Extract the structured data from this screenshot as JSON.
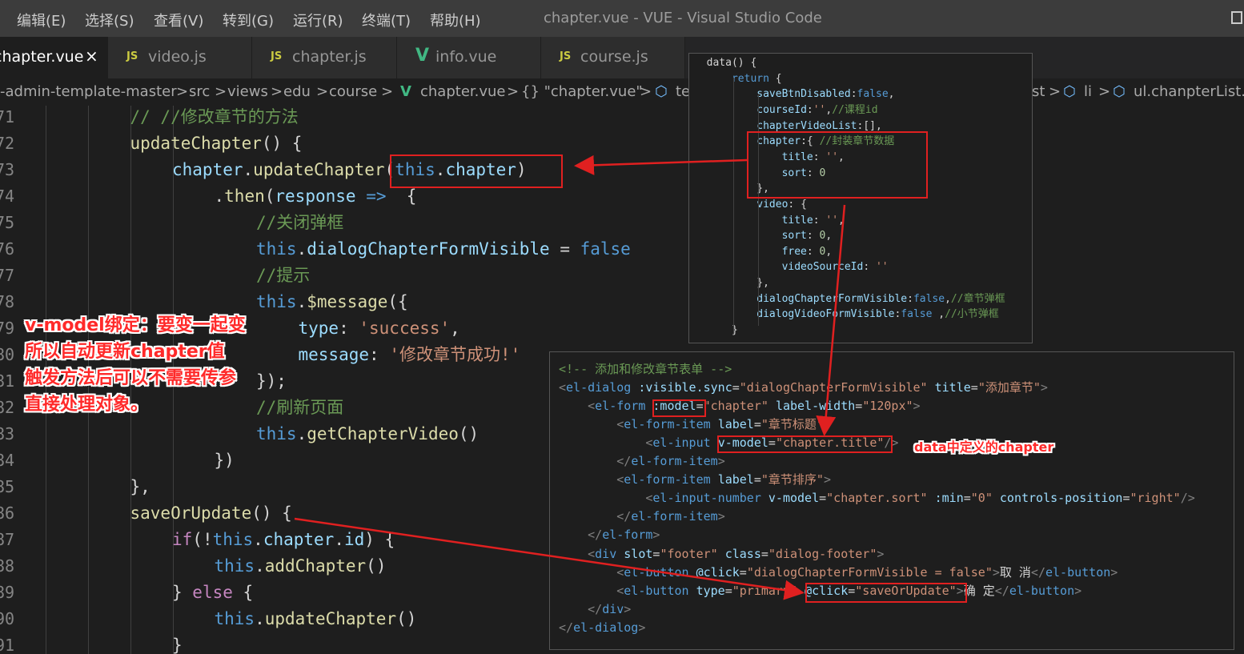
{
  "menu": [
    "编辑(E)",
    "选择(S)",
    "查看(V)",
    "转到(G)",
    "运行(R)",
    "终端(T)",
    "帮助(H)"
  ],
  "window_title": "chapter.vue - VUE - Visual Studio Code",
  "tabs": [
    {
      "label": "chapter.vue",
      "icon": "vue-icon",
      "active": true
    },
    {
      "label": "video.js",
      "icon": "js-icon",
      "active": false
    },
    {
      "label": "chapter.js",
      "icon": "js-icon",
      "active": false
    },
    {
      "label": "info.vue",
      "icon": "vue-icon",
      "active": false
    },
    {
      "label": "course.js",
      "icon": "js-icon",
      "active": false
    }
  ],
  "tab_icons": {
    "js": "JS",
    "vue": "V",
    "close": "×"
  },
  "breadcrumb": {
    "items": [
      "-admin-template-master",
      "src",
      "views",
      "edu",
      "course",
      "chapter.vue",
      "{} \"chapter.vue\"",
      "te"
    ],
    "tail": [
      "st",
      "li",
      "ul.chanpterList.v"
    ],
    "separator": ">"
  },
  "code_lines": [
    {
      "n": "71",
      "indent": 3,
      "tokens": [
        [
          "c-comment",
          "// //修改章节的方法"
        ]
      ]
    },
    {
      "n": "72",
      "indent": 3,
      "tokens": [
        [
          "c-fn",
          "updateChapter"
        ],
        [
          "c-punc",
          "() {"
        ]
      ]
    },
    {
      "n": "73",
      "indent": 4,
      "tokens": [
        [
          "c-var",
          "chapter"
        ],
        [
          "c-punc",
          "."
        ],
        [
          "c-fn",
          "updateChapter"
        ],
        [
          "c-punc",
          "("
        ],
        [
          "c-kw",
          "this"
        ],
        [
          "c-punc",
          "."
        ],
        [
          "c-var",
          "chapter"
        ],
        [
          "c-punc",
          ")"
        ]
      ]
    },
    {
      "n": "74",
      "indent": 5,
      "tokens": [
        [
          "c-punc",
          "."
        ],
        [
          "c-fn",
          "then"
        ],
        [
          "c-punc",
          "("
        ],
        [
          "c-var",
          "response"
        ],
        [
          "c-punc",
          " "
        ],
        [
          "c-kw",
          "=>"
        ],
        [
          "c-punc",
          "  {"
        ]
      ]
    },
    {
      "n": "75",
      "indent": 6,
      "tokens": [
        [
          "c-comment",
          "//关闭弹框"
        ]
      ]
    },
    {
      "n": "76",
      "indent": 6,
      "tokens": [
        [
          "c-kw",
          "this"
        ],
        [
          "c-punc",
          "."
        ],
        [
          "c-var",
          "dialogChapterFormVisible"
        ],
        [
          "c-punc",
          " = "
        ],
        [
          "c-kw",
          "false"
        ]
      ]
    },
    {
      "n": "77",
      "indent": 6,
      "tokens": [
        [
          "c-comment",
          "//提示"
        ]
      ]
    },
    {
      "n": "78",
      "indent": 6,
      "tokens": [
        [
          "c-kw",
          "this"
        ],
        [
          "c-punc",
          "."
        ],
        [
          "c-fn",
          "$message"
        ],
        [
          "c-punc",
          "({"
        ]
      ]
    },
    {
      "n": "79",
      "indent": 7,
      "tokens": [
        [
          "c-var",
          "type"
        ],
        [
          "c-punc",
          ": "
        ],
        [
          "c-str",
          "'success'"
        ],
        [
          "c-punc",
          ","
        ]
      ]
    },
    {
      "n": "80",
      "indent": 7,
      "tokens": [
        [
          "c-var",
          "message"
        ],
        [
          "c-punc",
          ": "
        ],
        [
          "c-str",
          "'修改章节成功!'"
        ]
      ]
    },
    {
      "n": "81",
      "indent": 6,
      "tokens": [
        [
          "c-punc",
          "});"
        ]
      ]
    },
    {
      "n": "82",
      "indent": 6,
      "tokens": [
        [
          "c-comment",
          "//刷新页面"
        ]
      ]
    },
    {
      "n": "83",
      "indent": 6,
      "tokens": [
        [
          "c-kw",
          "this"
        ],
        [
          "c-punc",
          "."
        ],
        [
          "c-fn",
          "getChapterVideo"
        ],
        [
          "c-punc",
          "()"
        ]
      ]
    },
    {
      "n": "84",
      "indent": 5,
      "tokens": [
        [
          "c-punc",
          "})"
        ]
      ]
    },
    {
      "n": "85",
      "indent": 3,
      "tokens": [
        [
          "c-punc",
          "},"
        ]
      ]
    },
    {
      "n": "86",
      "indent": 3,
      "tokens": [
        [
          "c-fn",
          "saveOrUpdate"
        ],
        [
          "c-punc",
          "() {"
        ]
      ]
    },
    {
      "n": "87",
      "indent": 4,
      "tokens": [
        [
          "c-ctrl",
          "if"
        ],
        [
          "c-punc",
          "(!"
        ],
        [
          "c-kw",
          "this"
        ],
        [
          "c-punc",
          "."
        ],
        [
          "c-var",
          "chapter"
        ],
        [
          "c-punc",
          "."
        ],
        [
          "c-var",
          "id"
        ],
        [
          "c-punc",
          ") {"
        ]
      ]
    },
    {
      "n": "88",
      "indent": 5,
      "tokens": [
        [
          "c-kw",
          "this"
        ],
        [
          "c-punc",
          "."
        ],
        [
          "c-fn",
          "addChapter"
        ],
        [
          "c-punc",
          "()"
        ]
      ]
    },
    {
      "n": "89",
      "indent": 4,
      "tokens": [
        [
          "c-punc",
          "} "
        ],
        [
          "c-ctrl",
          "else"
        ],
        [
          "c-punc",
          " {"
        ]
      ]
    },
    {
      "n": "90",
      "indent": 5,
      "tokens": [
        [
          "c-kw",
          "this"
        ],
        [
          "c-punc",
          "."
        ],
        [
          "c-fn",
          "updateChapter"
        ],
        [
          "c-punc",
          "()"
        ]
      ]
    },
    {
      "n": "91",
      "indent": 4,
      "tokens": [
        [
          "c-punc",
          "}"
        ]
      ]
    }
  ],
  "data_panel_lines": [
    [
      [
        "t-text",
        "  data() {"
      ]
    ],
    [
      [
        "t-text",
        "      "
      ],
      [
        "t-tag",
        "return"
      ],
      [
        "t-text",
        " {"
      ]
    ],
    [
      [
        "t-text",
        "          "
      ],
      [
        "t-attr",
        "saveBtnDisabled"
      ],
      [
        "t-text",
        ":"
      ],
      [
        "t-tag",
        "false"
      ],
      [
        "t-text",
        ","
      ]
    ],
    [
      [
        "t-text",
        "          "
      ],
      [
        "t-attr",
        "courseId"
      ],
      [
        "t-text",
        ":"
      ],
      [
        "t-str",
        "''"
      ],
      [
        "t-text",
        ","
      ],
      [
        "c-comment",
        "//课程id"
      ]
    ],
    [
      [
        "t-text",
        "          "
      ],
      [
        "t-attr",
        "chapterVideoList"
      ],
      [
        "t-text",
        ":[],"
      ]
    ],
    [
      [
        "t-text",
        "          "
      ],
      [
        "t-attr",
        "chapter"
      ],
      [
        "t-text",
        ":{ "
      ],
      [
        "c-comment",
        "//封装章节数据"
      ]
    ],
    [
      [
        "t-text",
        "              "
      ],
      [
        "t-attr",
        "title"
      ],
      [
        "t-text",
        ": "
      ],
      [
        "t-str",
        "''"
      ],
      [
        "t-text",
        ","
      ]
    ],
    [
      [
        "t-text",
        "              "
      ],
      [
        "t-attr",
        "sort"
      ],
      [
        "t-text",
        ": "
      ],
      [
        "c-num",
        "0"
      ]
    ],
    [
      [
        "t-text",
        "          },"
      ]
    ],
    [
      [
        "t-text",
        "          "
      ],
      [
        "t-attr",
        "video"
      ],
      [
        "t-text",
        ": {"
      ]
    ],
    [
      [
        "t-text",
        "              "
      ],
      [
        "t-attr",
        "title"
      ],
      [
        "t-text",
        ": "
      ],
      [
        "t-str",
        "''"
      ],
      [
        "t-text",
        ","
      ]
    ],
    [
      [
        "t-text",
        "              "
      ],
      [
        "t-attr",
        "sort"
      ],
      [
        "t-text",
        ": "
      ],
      [
        "c-num",
        "0"
      ],
      [
        "t-text",
        ","
      ]
    ],
    [
      [
        "t-text",
        "              "
      ],
      [
        "t-attr",
        "free"
      ],
      [
        "t-text",
        ": "
      ],
      [
        "c-num",
        "0"
      ],
      [
        "t-text",
        ","
      ]
    ],
    [
      [
        "t-text",
        "              "
      ],
      [
        "t-attr",
        "videoSourceId"
      ],
      [
        "t-text",
        ": "
      ],
      [
        "t-str",
        "''"
      ]
    ],
    [
      [
        "t-text",
        "          },"
      ]
    ],
    [
      [
        "t-text",
        "          "
      ],
      [
        "t-attr",
        "dialogChapterFormVisible"
      ],
      [
        "t-text",
        ":"
      ],
      [
        "t-tag",
        "false"
      ],
      [
        "t-text",
        ","
      ],
      [
        "c-comment",
        "//章节弹框"
      ]
    ],
    [
      [
        "t-text",
        "          "
      ],
      [
        "t-attr",
        "dialogVideoFormVisible"
      ],
      [
        "t-text",
        ":"
      ],
      [
        "t-tag",
        "false"
      ],
      [
        "t-text",
        " ,"
      ],
      [
        "c-comment",
        "//小节弹框"
      ]
    ],
    [
      [
        "t-text",
        "      }"
      ]
    ]
  ],
  "template_panel_lines": [
    [
      [
        "c-comment",
        "<!-- 添加和修改章节表单 -->"
      ]
    ],
    [
      [
        "t-punc",
        "<"
      ],
      [
        "t-tag",
        "el-dialog"
      ],
      [
        "t-text",
        " "
      ],
      [
        "t-attr",
        ":visible.sync"
      ],
      [
        "t-text",
        "="
      ],
      [
        "t-str",
        "\"dialogChapterFormVisible\""
      ],
      [
        "t-text",
        " "
      ],
      [
        "t-attr",
        "title"
      ],
      [
        "t-text",
        "="
      ],
      [
        "t-str",
        "\"添加章节\""
      ],
      [
        "t-punc",
        ">"
      ]
    ],
    [
      [
        "t-text",
        "    "
      ],
      [
        "t-punc",
        "<"
      ],
      [
        "t-tag",
        "el-form"
      ],
      [
        "t-text",
        " "
      ],
      [
        "t-attr",
        ":model"
      ],
      [
        "t-text",
        "="
      ],
      [
        "t-str",
        "\"chapter\""
      ],
      [
        "t-text",
        " "
      ],
      [
        "t-attr",
        "label-width"
      ],
      [
        "t-text",
        "="
      ],
      [
        "t-str",
        "\"120px\""
      ],
      [
        "t-punc",
        ">"
      ]
    ],
    [
      [
        "t-text",
        "        "
      ],
      [
        "t-punc",
        "<"
      ],
      [
        "t-tag",
        "el-form-item"
      ],
      [
        "t-text",
        " "
      ],
      [
        "t-attr",
        "label"
      ],
      [
        "t-text",
        "="
      ],
      [
        "t-str",
        "\"章节标题\""
      ],
      [
        "t-punc",
        ">"
      ]
    ],
    [
      [
        "t-text",
        "            "
      ],
      [
        "t-punc",
        "<"
      ],
      [
        "t-tag",
        "el-input"
      ],
      [
        "t-text",
        " "
      ],
      [
        "t-attr",
        "v-model"
      ],
      [
        "t-text",
        "="
      ],
      [
        "t-str",
        "\"chapter.title\""
      ],
      [
        "t-punc",
        "/>"
      ]
    ],
    [
      [
        "t-text",
        "        "
      ],
      [
        "t-punc",
        "</"
      ],
      [
        "t-tag",
        "el-form-item"
      ],
      [
        "t-punc",
        ">"
      ]
    ],
    [
      [
        "t-text",
        "        "
      ],
      [
        "t-punc",
        "<"
      ],
      [
        "t-tag",
        "el-form-item"
      ],
      [
        "t-text",
        " "
      ],
      [
        "t-attr",
        "label"
      ],
      [
        "t-text",
        "="
      ],
      [
        "t-str",
        "\"章节排序\""
      ],
      [
        "t-punc",
        ">"
      ]
    ],
    [
      [
        "t-text",
        "            "
      ],
      [
        "t-punc",
        "<"
      ],
      [
        "t-tag",
        "el-input-number"
      ],
      [
        "t-text",
        " "
      ],
      [
        "t-attr",
        "v-model"
      ],
      [
        "t-text",
        "="
      ],
      [
        "t-str",
        "\"chapter.sort\""
      ],
      [
        "t-text",
        " "
      ],
      [
        "t-attr",
        ":min"
      ],
      [
        "t-text",
        "="
      ],
      [
        "t-str",
        "\"0\""
      ],
      [
        "t-text",
        " "
      ],
      [
        "t-attr",
        "controls-position"
      ],
      [
        "t-text",
        "="
      ],
      [
        "t-str",
        "\"right\""
      ],
      [
        "t-punc",
        "/>"
      ]
    ],
    [
      [
        "t-text",
        "        "
      ],
      [
        "t-punc",
        "</"
      ],
      [
        "t-tag",
        "el-form-item"
      ],
      [
        "t-punc",
        ">"
      ]
    ],
    [
      [
        "t-text",
        "    "
      ],
      [
        "t-punc",
        "</"
      ],
      [
        "t-tag",
        "el-form"
      ],
      [
        "t-punc",
        ">"
      ]
    ],
    [
      [
        "t-text",
        "    "
      ],
      [
        "t-punc",
        "<"
      ],
      [
        "t-tag",
        "div"
      ],
      [
        "t-text",
        " "
      ],
      [
        "t-attr",
        "slot"
      ],
      [
        "t-text",
        "="
      ],
      [
        "t-str",
        "\"footer\""
      ],
      [
        "t-text",
        " "
      ],
      [
        "t-attr",
        "class"
      ],
      [
        "t-text",
        "="
      ],
      [
        "t-str",
        "\"dialog-footer\""
      ],
      [
        "t-punc",
        ">"
      ]
    ],
    [
      [
        "t-text",
        "        "
      ],
      [
        "t-punc",
        "<"
      ],
      [
        "t-tag",
        "el-button"
      ],
      [
        "t-text",
        " "
      ],
      [
        "t-attr",
        "@click"
      ],
      [
        "t-text",
        "="
      ],
      [
        "t-str",
        "\"dialogChapterFormVisible = false\""
      ],
      [
        "t-punc",
        ">"
      ],
      [
        "t-text",
        "取 消"
      ],
      [
        "t-punc",
        "</"
      ],
      [
        "t-tag",
        "el-button"
      ],
      [
        "t-punc",
        ">"
      ]
    ],
    [
      [
        "t-text",
        "        "
      ],
      [
        "t-punc",
        "<"
      ],
      [
        "t-tag",
        "el-button"
      ],
      [
        "t-text",
        " "
      ],
      [
        "t-attr",
        "type"
      ],
      [
        "t-text",
        "="
      ],
      [
        "t-str",
        "\"primary\""
      ],
      [
        "t-text",
        " "
      ],
      [
        "t-attr",
        "@click"
      ],
      [
        "t-text",
        "="
      ],
      [
        "t-str",
        "\"saveOrUpdate\""
      ],
      [
        "t-punc",
        ">"
      ],
      [
        "t-text",
        "确 定"
      ],
      [
        "t-punc",
        "</"
      ],
      [
        "t-tag",
        "el-button"
      ],
      [
        "t-punc",
        ">"
      ]
    ],
    [
      [
        "t-text",
        "    "
      ],
      [
        "t-punc",
        "</"
      ],
      [
        "t-tag",
        "div"
      ],
      [
        "t-punc",
        ">"
      ]
    ],
    [
      [
        "t-punc",
        "</"
      ],
      [
        "t-tag",
        "el-dialog"
      ],
      [
        "t-punc",
        ">"
      ]
    ]
  ],
  "annotations": {
    "vmodel_note": [
      "v-model绑定：要变一起变",
      "所以自动更新chapter值",
      "触发方法后可以不需要传参",
      "直接处理对象。"
    ],
    "data_note": "data中定义的chapter"
  },
  "colors": {
    "annotation": "#ff2a2a",
    "highlight_box": "#e02020"
  }
}
